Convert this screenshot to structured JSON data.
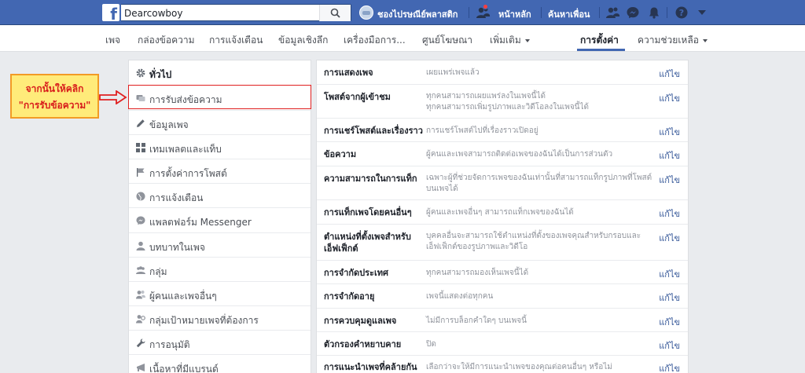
{
  "topbar": {
    "logo": "f",
    "search_value": "Dearcowboy",
    "page_name": "ชองไปรษณีย์พลาสติก",
    "home": "หน้าหลัก",
    "find_friends": "ค้นหาเพื่อน"
  },
  "nav": {
    "items": [
      "เพจ",
      "กล่องข้อความ",
      "การแจ้งเตือน",
      "ข้อมูลเชิงลึก",
      "เครื่องมือการ...",
      "ศูนย์โฆษณา",
      "เพิ่มเติม"
    ],
    "settings": "การตั้งค่า",
    "help": "ความช่วยเหลือ"
  },
  "sidebar": {
    "items": [
      {
        "label": "ทั่วไป",
        "icon": "gear-icon"
      },
      {
        "label": "การรับส่งข้อความ",
        "icon": "message-icon"
      },
      {
        "label": "ข้อมูลเพจ",
        "icon": "pencil-icon"
      },
      {
        "label": "เทมเพลตและแท็บ",
        "icon": "grid-icon"
      },
      {
        "label": "การตั้งค่าการโพสต์",
        "icon": "flag-icon"
      },
      {
        "label": "การแจ้งเตือน",
        "icon": "globe-icon"
      },
      {
        "label": "แพลตฟอร์ม Messenger",
        "icon": "messenger-icon"
      },
      {
        "label": "บทบาทในเพจ",
        "icon": "person-icon"
      },
      {
        "label": "กลุ่ม",
        "icon": "group-icon"
      },
      {
        "label": "ผู้คนและเพจอื่นๆ",
        "icon": "people-icon"
      },
      {
        "label": "กลุ่มเป้าหมายเพจที่ต้องการ",
        "icon": "audience-icon"
      },
      {
        "label": "การอนุมัติ",
        "icon": "wrench-icon"
      },
      {
        "label": "เนื้อหาที่มีแบรนด์",
        "icon": "branded-icon"
      }
    ]
  },
  "annotation": {
    "line1": "จากนั้นให้คลิก",
    "line2": "\"การรับข้อความ\""
  },
  "settings": {
    "edit_label": "แก้ไข",
    "rows": [
      {
        "label": "การแสดงเพจ",
        "value": "เผยแพร่เพจแล้ว"
      },
      {
        "label": "โพสต์จากผู้เข้าชม",
        "value": "ทุกคนสามารถเผยแพร่ลงในเพจนี้ได้\nทุกคนสามารถเพิ่มรูปภาพและวิดีโอลงในเพจนี้ได้"
      },
      {
        "label": "การแชร์โพสต์และเรื่องราว",
        "value": "การแชร์โพสต์ไปที่เรื่องราวเปิดอยู่"
      },
      {
        "label": "ข้อความ",
        "value": "ผู้คนและเพจสามารถติดต่อเพจของฉันได้เป็นการส่วนตัว"
      },
      {
        "label": "ความสามารถในการแท็ก",
        "value": "เฉพาะผู้ที่ช่วยจัดการเพจของฉันเท่านั้นที่สามารถแท็กรูปภาพที่โพสต์บนเพจได้"
      },
      {
        "label": "การแท็กเพจโดยคนอื่นๆ",
        "value": "ผู้คนและเพจอื่นๆ สามารถแท็กเพจของฉันได้"
      },
      {
        "label": "ตำแหน่งที่ตั้งเพจสำหรับเอ็ฟเฟ็กต์",
        "value": "บุคคลอื่นจะสามารถใช้ตำแหน่งที่ตั้งของเพจคุณสำหรับกรอบและเอ็ฟเฟ็กต์ของรูปภาพและวิดีโอ"
      },
      {
        "label": "การจำกัดประเทศ",
        "value": "ทุกคนสามารถมองเห็นเพจนี้ได้"
      },
      {
        "label": "การจำกัดอายุ",
        "value": "เพจนี้แสดงต่อทุกคน"
      },
      {
        "label": "การควบคุมดูแลเพจ",
        "value": "ไม่มีการบล็อกคำใดๆ บนเพจนี้"
      },
      {
        "label": "ตัวกรองคำหยาบคาย",
        "value": "ปิด"
      },
      {
        "label": "การแนะนำเพจที่คล้ายกัน",
        "value": "เลือกว่าจะให้มีการแนะนำเพจของคุณต่อคนอื่นๆ หรือไม่"
      }
    ]
  }
}
